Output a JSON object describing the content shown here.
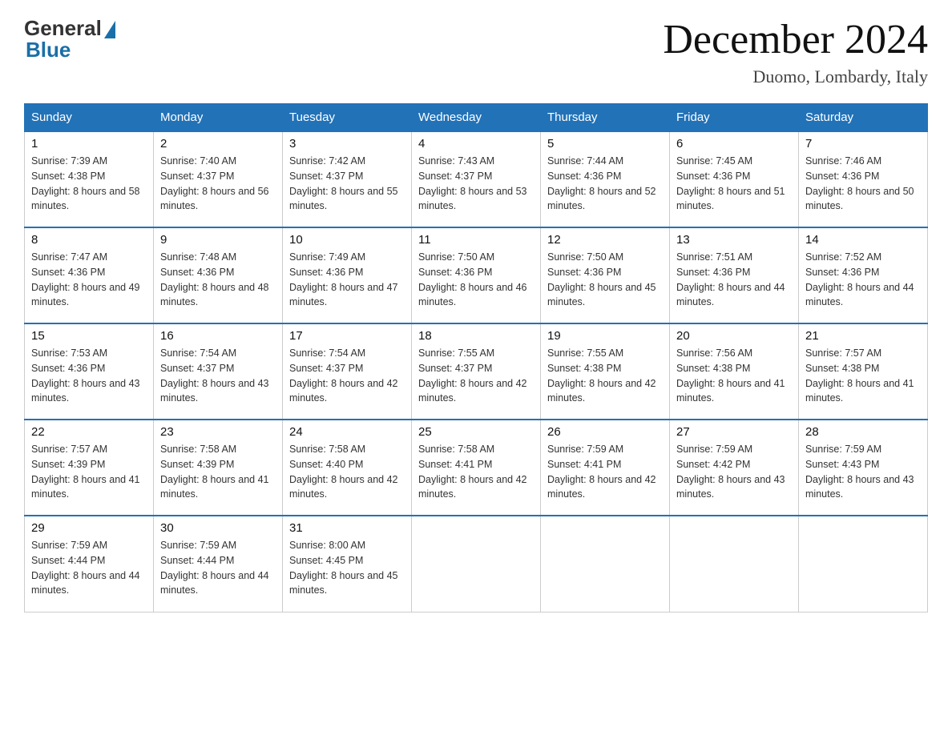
{
  "logo": {
    "general": "General",
    "blue": "Blue"
  },
  "header": {
    "month_title": "December 2024",
    "location": "Duomo, Lombardy, Italy"
  },
  "weekdays": [
    "Sunday",
    "Monday",
    "Tuesday",
    "Wednesday",
    "Thursday",
    "Friday",
    "Saturday"
  ],
  "weeks": [
    [
      {
        "day": "1",
        "sunrise": "7:39 AM",
        "sunset": "4:38 PM",
        "daylight": "8 hours and 58 minutes."
      },
      {
        "day": "2",
        "sunrise": "7:40 AM",
        "sunset": "4:37 PM",
        "daylight": "8 hours and 56 minutes."
      },
      {
        "day": "3",
        "sunrise": "7:42 AM",
        "sunset": "4:37 PM",
        "daylight": "8 hours and 55 minutes."
      },
      {
        "day": "4",
        "sunrise": "7:43 AM",
        "sunset": "4:37 PM",
        "daylight": "8 hours and 53 minutes."
      },
      {
        "day": "5",
        "sunrise": "7:44 AM",
        "sunset": "4:36 PM",
        "daylight": "8 hours and 52 minutes."
      },
      {
        "day": "6",
        "sunrise": "7:45 AM",
        "sunset": "4:36 PM",
        "daylight": "8 hours and 51 minutes."
      },
      {
        "day": "7",
        "sunrise": "7:46 AM",
        "sunset": "4:36 PM",
        "daylight": "8 hours and 50 minutes."
      }
    ],
    [
      {
        "day": "8",
        "sunrise": "7:47 AM",
        "sunset": "4:36 PM",
        "daylight": "8 hours and 49 minutes."
      },
      {
        "day": "9",
        "sunrise": "7:48 AM",
        "sunset": "4:36 PM",
        "daylight": "8 hours and 48 minutes."
      },
      {
        "day": "10",
        "sunrise": "7:49 AM",
        "sunset": "4:36 PM",
        "daylight": "8 hours and 47 minutes."
      },
      {
        "day": "11",
        "sunrise": "7:50 AM",
        "sunset": "4:36 PM",
        "daylight": "8 hours and 46 minutes."
      },
      {
        "day": "12",
        "sunrise": "7:50 AM",
        "sunset": "4:36 PM",
        "daylight": "8 hours and 45 minutes."
      },
      {
        "day": "13",
        "sunrise": "7:51 AM",
        "sunset": "4:36 PM",
        "daylight": "8 hours and 44 minutes."
      },
      {
        "day": "14",
        "sunrise": "7:52 AM",
        "sunset": "4:36 PM",
        "daylight": "8 hours and 44 minutes."
      }
    ],
    [
      {
        "day": "15",
        "sunrise": "7:53 AM",
        "sunset": "4:36 PM",
        "daylight": "8 hours and 43 minutes."
      },
      {
        "day": "16",
        "sunrise": "7:54 AM",
        "sunset": "4:37 PM",
        "daylight": "8 hours and 43 minutes."
      },
      {
        "day": "17",
        "sunrise": "7:54 AM",
        "sunset": "4:37 PM",
        "daylight": "8 hours and 42 minutes."
      },
      {
        "day": "18",
        "sunrise": "7:55 AM",
        "sunset": "4:37 PM",
        "daylight": "8 hours and 42 minutes."
      },
      {
        "day": "19",
        "sunrise": "7:55 AM",
        "sunset": "4:38 PM",
        "daylight": "8 hours and 42 minutes."
      },
      {
        "day": "20",
        "sunrise": "7:56 AM",
        "sunset": "4:38 PM",
        "daylight": "8 hours and 41 minutes."
      },
      {
        "day": "21",
        "sunrise": "7:57 AM",
        "sunset": "4:38 PM",
        "daylight": "8 hours and 41 minutes."
      }
    ],
    [
      {
        "day": "22",
        "sunrise": "7:57 AM",
        "sunset": "4:39 PM",
        "daylight": "8 hours and 41 minutes."
      },
      {
        "day": "23",
        "sunrise": "7:58 AM",
        "sunset": "4:39 PM",
        "daylight": "8 hours and 41 minutes."
      },
      {
        "day": "24",
        "sunrise": "7:58 AM",
        "sunset": "4:40 PM",
        "daylight": "8 hours and 42 minutes."
      },
      {
        "day": "25",
        "sunrise": "7:58 AM",
        "sunset": "4:41 PM",
        "daylight": "8 hours and 42 minutes."
      },
      {
        "day": "26",
        "sunrise": "7:59 AM",
        "sunset": "4:41 PM",
        "daylight": "8 hours and 42 minutes."
      },
      {
        "day": "27",
        "sunrise": "7:59 AM",
        "sunset": "4:42 PM",
        "daylight": "8 hours and 43 minutes."
      },
      {
        "day": "28",
        "sunrise": "7:59 AM",
        "sunset": "4:43 PM",
        "daylight": "8 hours and 43 minutes."
      }
    ],
    [
      {
        "day": "29",
        "sunrise": "7:59 AM",
        "sunset": "4:44 PM",
        "daylight": "8 hours and 44 minutes."
      },
      {
        "day": "30",
        "sunrise": "7:59 AM",
        "sunset": "4:44 PM",
        "daylight": "8 hours and 44 minutes."
      },
      {
        "day": "31",
        "sunrise": "8:00 AM",
        "sunset": "4:45 PM",
        "daylight": "8 hours and 45 minutes."
      },
      null,
      null,
      null,
      null
    ]
  ]
}
